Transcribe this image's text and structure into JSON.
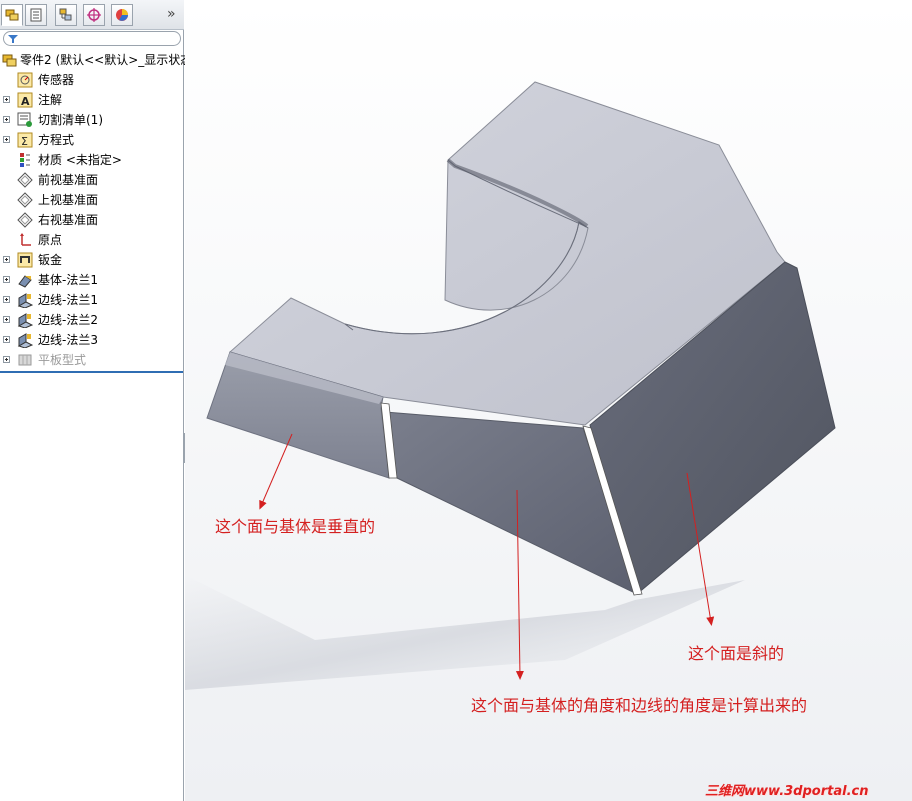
{
  "panel": {
    "tabs": [
      {
        "name": "feature-manager",
        "active": true
      },
      {
        "name": "property-manager",
        "active": false
      },
      {
        "name": "configuration-manager",
        "active": false
      },
      {
        "name": "dimxpert-manager",
        "active": false
      },
      {
        "name": "display-manager",
        "active": false
      }
    ],
    "expand_glyph": "»"
  },
  "tree": {
    "root_label": "零件2 (默认<<默认>_显示状态",
    "items": [
      {
        "label": "传感器",
        "icon": "sensor-icon",
        "expandable": false
      },
      {
        "label": "注解",
        "icon": "annotation-icon",
        "expandable": true
      },
      {
        "label": "切割清单(1)",
        "icon": "cut-list-icon",
        "expandable": true
      },
      {
        "label": "方程式",
        "icon": "equation-icon",
        "expandable": true
      },
      {
        "label": "材质 <未指定>",
        "icon": "material-icon",
        "expandable": false
      },
      {
        "label": "前视基准面",
        "icon": "plane-icon",
        "expandable": false
      },
      {
        "label": "上视基准面",
        "icon": "plane-icon",
        "expandable": false
      },
      {
        "label": "右视基准面",
        "icon": "plane-icon",
        "expandable": false
      },
      {
        "label": "原点",
        "icon": "origin-icon",
        "expandable": false
      },
      {
        "label": "钣金",
        "icon": "sheet-metal-icon",
        "expandable": true
      },
      {
        "label": "基体-法兰1",
        "icon": "base-flange-icon",
        "expandable": true
      },
      {
        "label": "边线-法兰1",
        "icon": "edge-flange-icon",
        "expandable": true
      },
      {
        "label": "边线-法兰2",
        "icon": "edge-flange-icon",
        "expandable": true
      },
      {
        "label": "边线-法兰3",
        "icon": "edge-flange-icon",
        "expandable": true
      },
      {
        "label": "平板型式",
        "icon": "flat-pattern-icon",
        "expandable": true,
        "disabled": true
      }
    ]
  },
  "annotations": {
    "perpendicular": "这个面与基体是垂直的",
    "inclined": "这个面是斜的",
    "computed": "这个面与基体的角度和边线的角度是计算出来的"
  },
  "watermark": "三维网www.3dportal.cn",
  "colors": {
    "annotation_text": "#d42020",
    "arrow": "#d42020",
    "top_face": "#c9cbd6",
    "side_face": "#5e6272",
    "rollback_bar": "#2f6db3"
  }
}
